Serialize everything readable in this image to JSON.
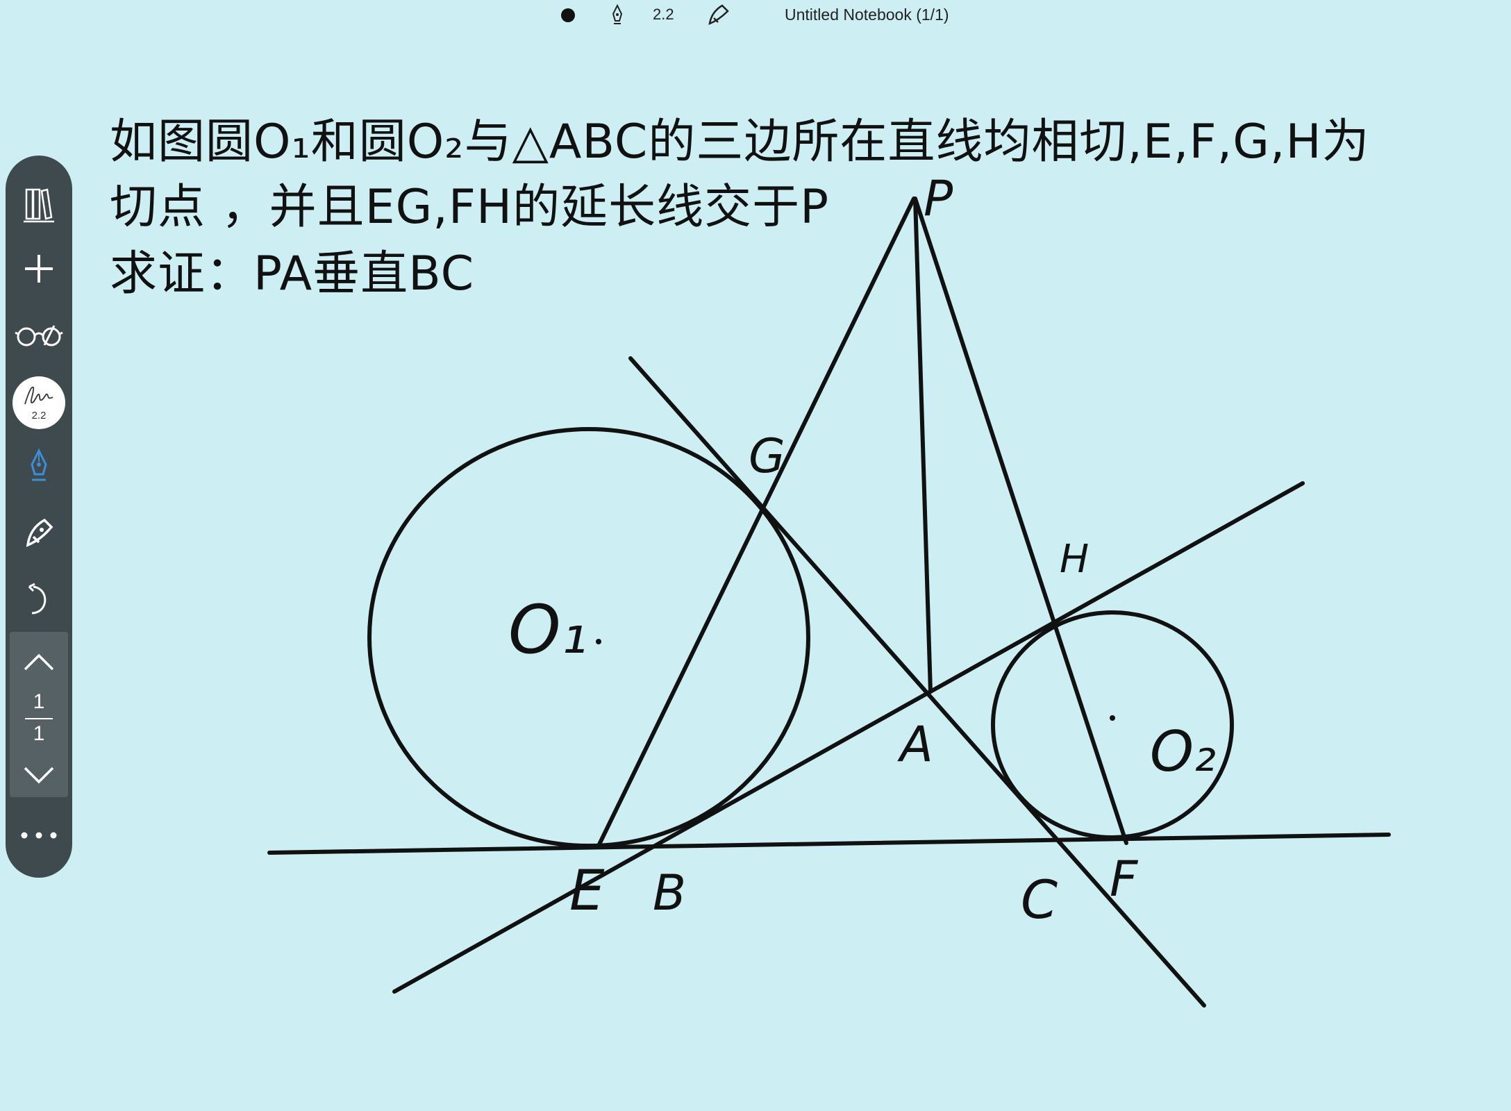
{
  "topbar": {
    "pen_size": "2.2",
    "notebook_title": "Untitled Notebook (1/1)"
  },
  "toolbar": {
    "pen_size_badge": "2.2",
    "current_page": "1",
    "total_pages": "1",
    "accent_color": "#3b8fd9"
  },
  "problem": {
    "line1": "如图圆O₁和圆O₂与△ABC的三边所在直线均相切,E,F,G,H为",
    "line2": "切点 ，并且EG,FH的延长线交于P",
    "line3": "求证：PA垂直BC"
  },
  "figure": {
    "labels": {
      "P": "P",
      "G": "G",
      "H": "H",
      "A": "A",
      "O1": "O₁",
      "O2": "O₂",
      "E": "E",
      "B": "B",
      "C": "C",
      "F": "F"
    }
  }
}
